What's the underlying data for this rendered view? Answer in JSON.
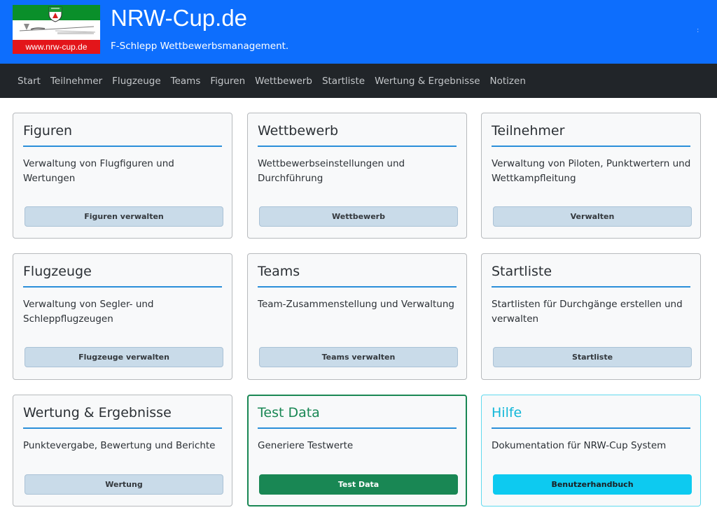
{
  "header": {
    "logo_url_text": "www.nrw-cup.de",
    "title": "NRW-Cup.de",
    "subtitle": "F-Schlepp Wettbewerbsmanagement."
  },
  "nav": {
    "items": [
      "Start",
      "Teilnehmer",
      "Flugzeuge",
      "Teams",
      "Figuren",
      "Wettbewerb",
      "Startliste",
      "Wertung & Ergebnisse",
      "Notizen"
    ]
  },
  "cards": [
    {
      "title": "Figuren",
      "text": "Verwaltung von Flugfiguren und Wertungen",
      "button": "Figuren verwalten"
    },
    {
      "title": "Wettbewerb",
      "text": "Wettbewerbseinstellungen und Durchführung",
      "button": "Wettbewerb"
    },
    {
      "title": "Teilnehmer",
      "text": "Verwaltung von Piloten, Punktwertern und Wettkampfleitung",
      "button": "Verwalten"
    },
    {
      "title": "Flugzeuge",
      "text": "Verwaltung von Segler- und Schleppflugzeugen",
      "button": "Flugzeuge verwalten"
    },
    {
      "title": "Teams",
      "text": "Team-Zusammenstellung und Verwaltung",
      "button": "Teams verwalten"
    },
    {
      "title": "Startliste",
      "text": "Startlisten für Durchgänge erstellen und verwalten",
      "button": "Startliste"
    },
    {
      "title": "Wertung & Ergebnisse",
      "text": "Punktevergabe, Bewertung und Berichte",
      "button": "Wertung"
    },
    {
      "title": "Test Data",
      "text": "Generiere Testwerte",
      "button": "Test Data"
    },
    {
      "title": "Hilfe",
      "text": "Dokumentation für NRW-Cup System",
      "button": "Benutzerhandbuch"
    }
  ],
  "colors": {
    "header_blue": "#0d6efd",
    "nav_dark": "#212529",
    "success_green": "#198754",
    "info_cyan": "#0dcaf0"
  },
  "icons": {
    "logo": "nrw-crest-glider-logo"
  }
}
